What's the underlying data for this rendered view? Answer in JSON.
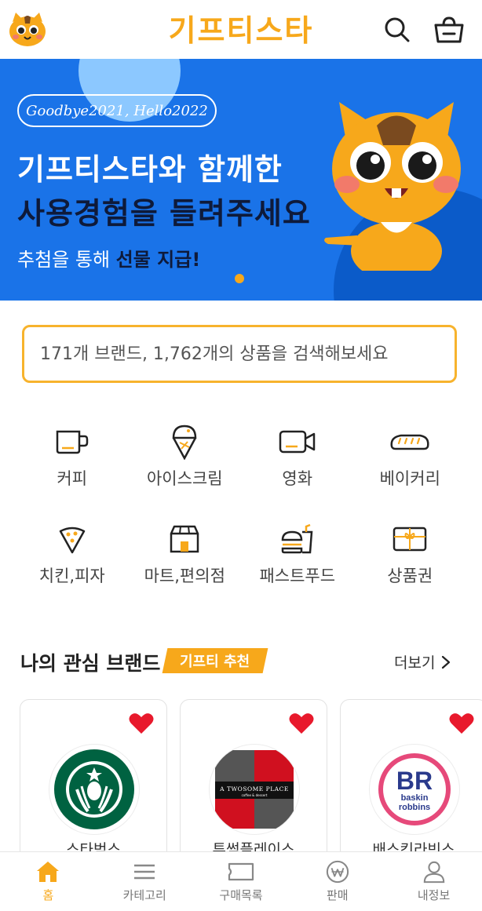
{
  "header": {
    "title": "기프티스타",
    "logo_icon": "squirrel-mascot-icon",
    "search_icon": "search-icon",
    "cart_icon": "shopping-basket-icon"
  },
  "banner": {
    "pill_text": "Goodbye2021, Hello2022",
    "line1": "기프티스타와 함께한",
    "line2": "사용경험을 들려주세요",
    "line3_prefix": "추첨을 통해 ",
    "line3_highlight": "선물 지급!",
    "background_color": "#1a73e8",
    "accent_color": "#f7a81b"
  },
  "search": {
    "placeholder": "171개 브랜드, 1,762개의 상품을 검색해보세요"
  },
  "categories": [
    {
      "label": "커피",
      "icon": "coffee-cup-icon"
    },
    {
      "label": "아이스크림",
      "icon": "ice-cream-icon"
    },
    {
      "label": "영화",
      "icon": "video-camera-icon"
    },
    {
      "label": "베이커리",
      "icon": "bread-icon"
    },
    {
      "label": "치킨,피자",
      "icon": "pizza-slice-icon"
    },
    {
      "label": "마트,편의점",
      "icon": "store-icon"
    },
    {
      "label": "패스트푸드",
      "icon": "burger-drink-icon"
    },
    {
      "label": "상품권",
      "icon": "gift-card-icon"
    }
  ],
  "interest_section": {
    "title": "나의 관심 브랜드",
    "badge": "기프티 추천",
    "more_label": "더보기",
    "brands": [
      {
        "name": "스타벅스",
        "logo": "starbucks-logo-icon",
        "favorited": true
      },
      {
        "name": "투썸플레이스",
        "logo": "twosome-place-logo-icon",
        "favorited": true,
        "logo_text": "A TWOSOME PLACE",
        "logo_subtext": "coffee & dessert"
      },
      {
        "name": "배스킨라빈스",
        "logo": "baskin-robbins-logo-icon",
        "favorited": true,
        "logo_text_1": "baskin",
        "logo_text_2": "robbins"
      }
    ]
  },
  "bottom_nav": {
    "items": [
      {
        "label": "홈",
        "icon": "home-icon",
        "active": true
      },
      {
        "label": "카테고리",
        "icon": "menu-icon",
        "active": false
      },
      {
        "label": "구매목록",
        "icon": "ticket-icon",
        "active": false
      },
      {
        "label": "판매",
        "icon": "won-coin-icon",
        "active": false
      },
      {
        "label": "내정보",
        "icon": "user-icon",
        "active": false
      }
    ]
  },
  "colors": {
    "brand_yellow": "#f7a81b",
    "heart_red": "#e8192c",
    "text_dark": "#222222"
  }
}
